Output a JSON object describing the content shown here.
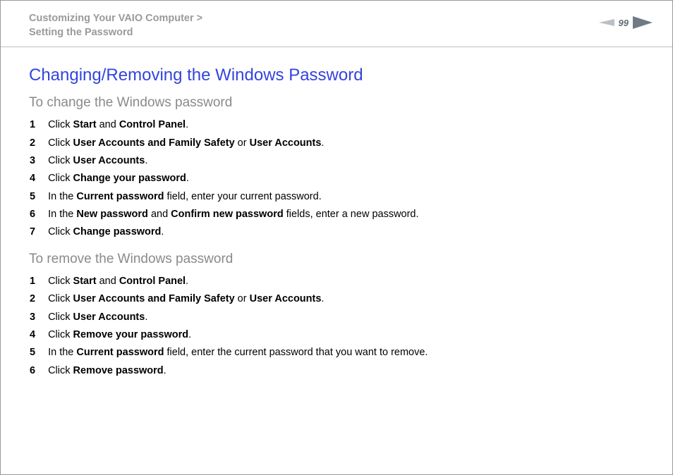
{
  "header": {
    "breadcrumb_line1": "Customizing Your VAIO Computer >",
    "breadcrumb_line2": "Setting the Password",
    "page_number": "99"
  },
  "title": "Changing/Removing the Windows Password",
  "section_change": {
    "subtitle": "To change the Windows password",
    "steps": [
      {
        "n": "1",
        "pre": "Click ",
        "b1": "Start",
        "mid1": " and ",
        "b2": "Control Panel",
        "post": "."
      },
      {
        "n": "2",
        "pre": "Click ",
        "b1": "User Accounts and Family Safety",
        "mid1": " or ",
        "b2": "User Accounts",
        "post": "."
      },
      {
        "n": "3",
        "pre": "Click ",
        "b1": "User Accounts",
        "post": "."
      },
      {
        "n": "4",
        "pre": "Click ",
        "b1": "Change your password",
        "post": "."
      },
      {
        "n": "5",
        "pre": "In the ",
        "b1": "Current password",
        "post": " field, enter your current password."
      },
      {
        "n": "6",
        "pre": "In the ",
        "b1": "New password",
        "mid1": " and ",
        "b2": "Confirm new password",
        "post": " fields, enter a new password."
      },
      {
        "n": "7",
        "pre": "Click ",
        "b1": "Change password",
        "post": "."
      }
    ]
  },
  "section_remove": {
    "subtitle": "To remove the Windows password",
    "steps": [
      {
        "n": "1",
        "pre": "Click ",
        "b1": "Start",
        "mid1": " and ",
        "b2": "Control Panel",
        "post": "."
      },
      {
        "n": "2",
        "pre": "Click ",
        "b1": "User Accounts and Family Safety",
        "mid1": " or ",
        "b2": "User Accounts",
        "post": "."
      },
      {
        "n": "3",
        "pre": "Click ",
        "b1": "User Accounts",
        "post": "."
      },
      {
        "n": "4",
        "pre": "Click ",
        "b1": "Remove your password",
        "post": "."
      },
      {
        "n": "5",
        "pre": "In the ",
        "b1": "Current password",
        "post": " field, enter the current password that you want to remove."
      },
      {
        "n": "6",
        "pre": "Click ",
        "b1": "Remove password",
        "post": "."
      }
    ]
  }
}
